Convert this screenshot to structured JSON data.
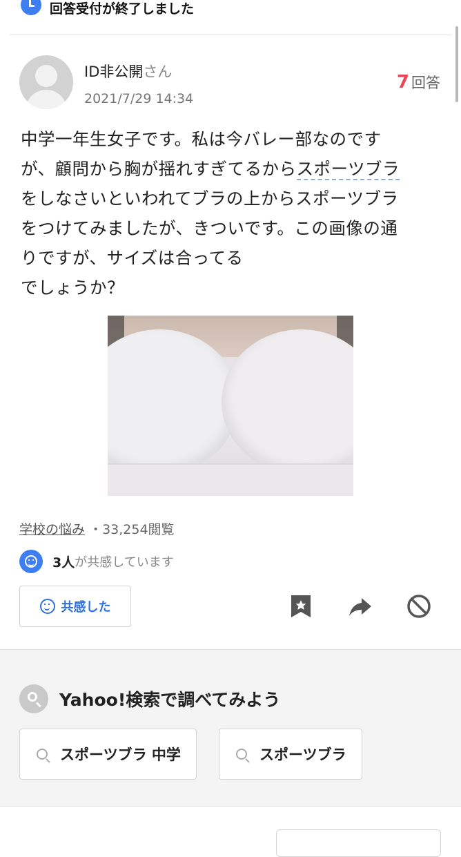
{
  "status": {
    "text": "回答受付が終了しました",
    "icon": "clock-icon"
  },
  "question": {
    "user_name": "ID非公開",
    "user_suffix": "さん",
    "date": "2021/7/29 14:34",
    "answer_count": "7",
    "answer_label": "回答",
    "body_lines": [
      "中学一年生女子です。私は今バレー部なのです",
      "が、顧問から胸が揺れすぎてるから",
      "をしなさいといわれてブラの上からスポーツブラ",
      "をつけてみましたが、きついです。この画像の通",
      "りですが、サイズは合ってる",
      "でしょうか？"
    ],
    "keyword_link": "スポーツブラ",
    "category": "学校の悩み",
    "separator": "・",
    "views": "33,254閲覧",
    "empathy_count": "3人",
    "empathy_text": "が共感しています",
    "empathy_button": "共感した"
  },
  "actions": [
    "bookmark-icon",
    "share-icon",
    "block-icon"
  ],
  "search": {
    "title": "Yahoo!検索で調べてみよう",
    "chips": [
      "スポーツブラ 中学",
      "スポーツブラ"
    ]
  },
  "colors": {
    "accent": "#3d7ff0",
    "answer_count": "#ee4455"
  }
}
